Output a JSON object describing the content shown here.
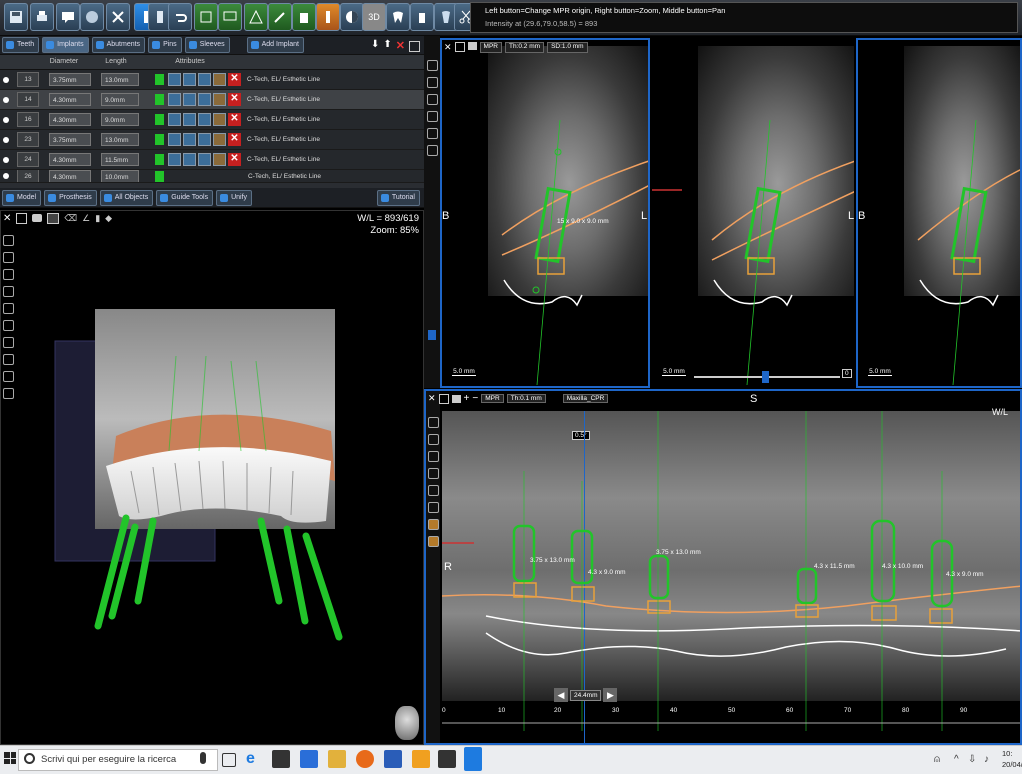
{
  "hint": {
    "line1": "Left button=Change MPR origin, Right button=Zoom, Middle button=Pan",
    "line2": "Intensity at (29.6,79.0,58.5) = 893"
  },
  "implant_panel": {
    "tabs": [
      "Teeth",
      "Implants",
      "Abutments",
      "Pins",
      "Sleeves",
      "Add Implant"
    ],
    "columns": [
      "Diameter",
      "Length",
      "Attributes"
    ],
    "rows": [
      {
        "num": "13",
        "diameter": "3.75mm",
        "length": "13.0mm",
        "desc": "C-Tech, EL/ Esthetic Line"
      },
      {
        "num": "14",
        "diameter": "4.30mm",
        "length": "9.0mm",
        "desc": "C-Tech, EL/ Esthetic Line"
      },
      {
        "num": "16",
        "diameter": "4.30mm",
        "length": "9.0mm",
        "desc": "C-Tech, EL/ Esthetic Line"
      },
      {
        "num": "23",
        "diameter": "3.75mm",
        "length": "13.0mm",
        "desc": "C-Tech, EL/ Esthetic Line"
      },
      {
        "num": "24",
        "diameter": "4.30mm",
        "length": "11.5mm",
        "desc": "C-Tech, EL/ Esthetic Line"
      },
      {
        "num": "26",
        "diameter": "4.30mm",
        "length": "10.0mm",
        "desc": "C-Tech, EL/ Esthetic Line"
      }
    ],
    "bottom_tabs": [
      "Model",
      "Prosthesis",
      "All Objects",
      "Guide Tools",
      "Unify",
      "Tutorial"
    ]
  },
  "view3d": {
    "wl": "W/L = 893/619",
    "zoom": "Zoom: 85%"
  },
  "mpr_top": {
    "toolbar": [
      "MPR",
      "Th:0.2 mm",
      "SD:1.0 mm"
    ],
    "side_label_left": "B",
    "side_label_right": "L",
    "scale": "5.0 mm",
    "slider_value": "0",
    "measure": "15 x 9.0 x 9.0 mm"
  },
  "mpr_pan": {
    "toolbar": [
      "MPR",
      "Th:0.1 mm",
      "Maxilla_CPR"
    ],
    "top_label": "S",
    "left_label": "R",
    "angle": "0.5°",
    "wl_short": "W/L",
    "distance": "24.4mm",
    "ruler": [
      "0",
      "10",
      "20",
      "30",
      "40",
      "50",
      "60",
      "70",
      "80",
      "90"
    ],
    "measures": [
      "3.75 x 13.0 mm",
      "4.3 x 9.0 mm",
      "3.75 x 13.0 mm",
      "4.3 x 11.5 mm",
      "4.3 x 10.0 mm",
      "4.3 x 9.0 mm"
    ]
  },
  "taskbar": {
    "search_placeholder": "Scrivi qui per eseguire la ricerca",
    "time": "10:",
    "date": "20/04/"
  },
  "colors": {
    "accent": "#1e66c8",
    "implant": "#22c42a",
    "crown": "#e8a13a",
    "nerve": "#f0a060"
  }
}
